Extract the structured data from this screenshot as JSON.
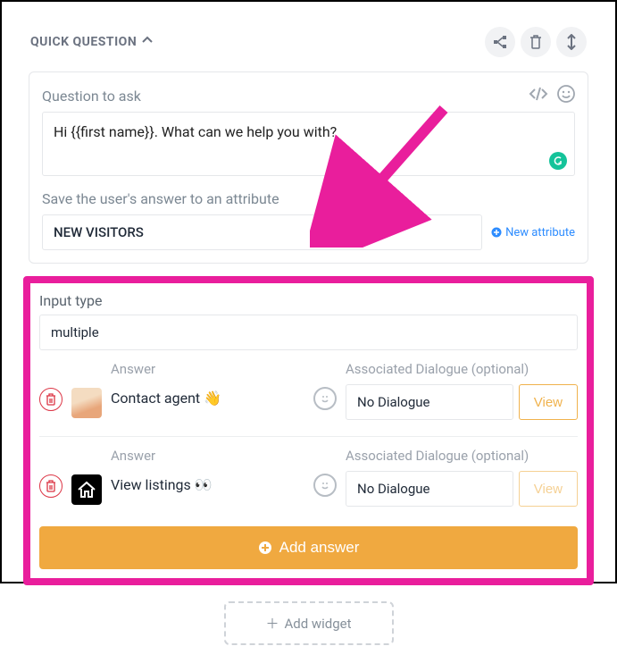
{
  "header": {
    "title": "QUICK QUESTION"
  },
  "question": {
    "label": "Question to ask",
    "value": "Hi {{first name}}. What can we help you with?"
  },
  "attribute": {
    "label": "Save the user's answer to an attribute",
    "value": "NEW VISITORS",
    "new_link": "New attribute"
  },
  "input_type": {
    "label": "Input type",
    "value": "multiple"
  },
  "answers": [
    {
      "answer_label": "Answer",
      "answer_value": "Contact agent 👋",
      "dialogue_label": "Associated Dialogue (optional)",
      "dialogue_value": "No Dialogue",
      "view_label": "View",
      "avatar_bg": "#f4c59a"
    },
    {
      "answer_label": "Answer",
      "answer_value": "View listings 👀",
      "dialogue_label": "Associated Dialogue (optional)",
      "dialogue_value": "No Dialogue",
      "view_label": "View",
      "avatar_bg": "#000000"
    }
  ],
  "add_answer_label": "Add answer",
  "add_widget_label": "Add widget"
}
